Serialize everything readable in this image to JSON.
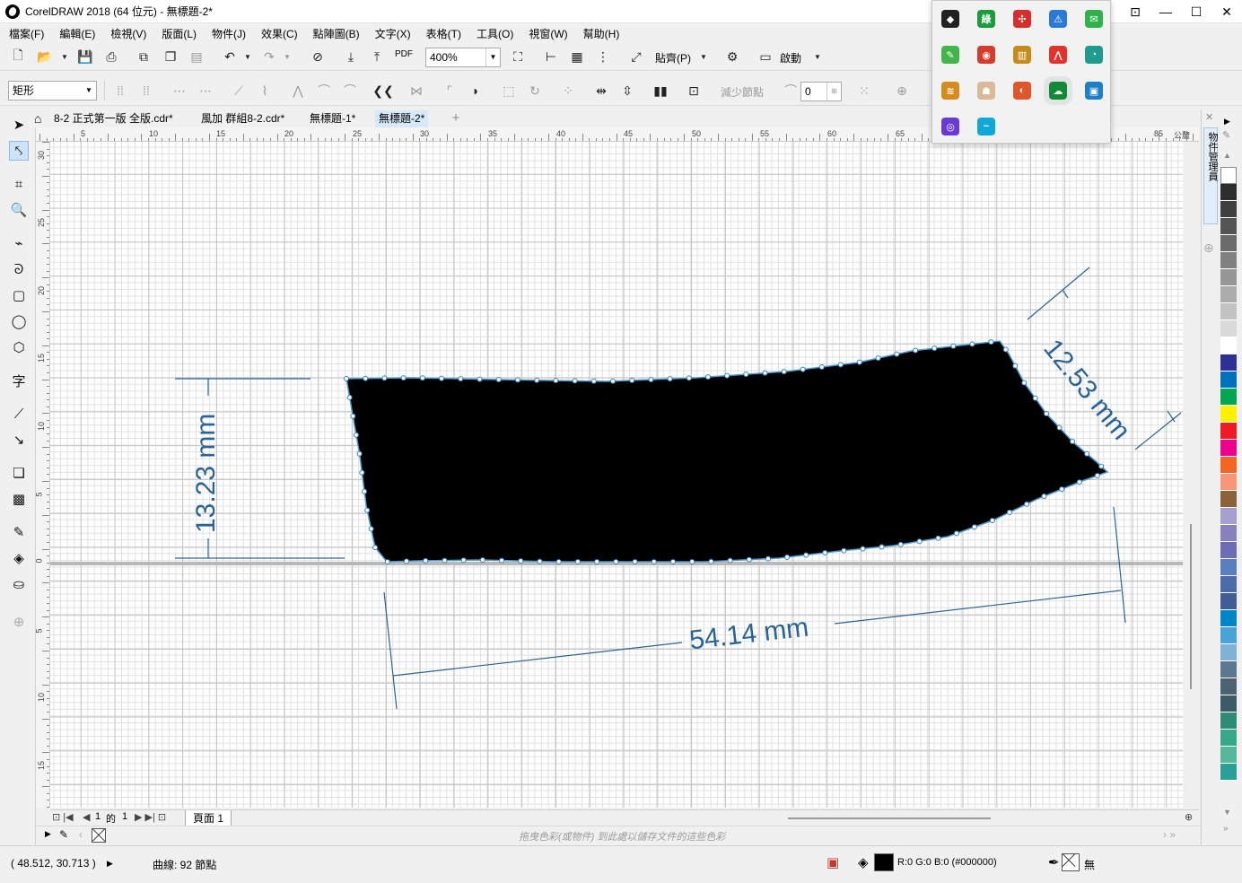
{
  "window": {
    "title": "CorelDRAW 2018 (64 位元) - 無標題-2*"
  },
  "menu": [
    "檔案(F)",
    "編輯(E)",
    "檢視(V)",
    "版面(L)",
    "物件(J)",
    "效果(C)",
    "點陣圖(B)",
    "文字(X)",
    "表格(T)",
    "工具(O)",
    "視窗(W)",
    "幫助(H)"
  ],
  "toolbar": {
    "zoom": "400%",
    "paste_label": "貼齊(P)",
    "launch_label": "啟動",
    "pdf_label": "PDF"
  },
  "propertybar": {
    "shape_type": "矩形",
    "reduce_nodes": "減少節點",
    "smoothness": "0"
  },
  "doc_tabs": [
    "8-2 正式第一版 全版.cdr*",
    "風加 群組8-2.cdr*",
    "無標題-1*",
    "無標題-2*"
  ],
  "ruler": {
    "unit": "公釐",
    "top_labels": [
      "5",
      "10",
      "15",
      "20",
      "25",
      "30",
      "35",
      "40",
      "45",
      "50",
      "55",
      "60",
      "65",
      "85"
    ],
    "left_labels": [
      "30",
      "25",
      "20",
      "15",
      "10",
      "5",
      "0",
      "5",
      "10",
      "15"
    ]
  },
  "dimensions": {
    "height": "13.23 mm",
    "width": "54.14 mm",
    "side": "12.53 mm"
  },
  "page_nav": {
    "current": "1",
    "of": "的",
    "total": "1",
    "page_label": "頁面 1"
  },
  "colorbar": {
    "hint": "拖曳色彩(或物件) 到此處以儲存文件的這些色彩"
  },
  "status": {
    "coords": "( 48.512, 30.713 )",
    "info": "曲線: 92 節點",
    "fill_text": "R:0 G:0 B:0 (#000000)",
    "outline_text": "無",
    "fill_color": "#000000"
  },
  "docker": {
    "label": "物件管理員"
  },
  "palette": [
    "#ffffff",
    "#2d2d2d",
    "#404040",
    "#555555",
    "#6b6b6b",
    "#808080",
    "#969696",
    "#acacac",
    "#c2c2c2",
    "#d9d9d9",
    "#ffffff",
    "#2e3192",
    "#0071bc",
    "#00a651",
    "#fff200",
    "#ed1c24",
    "#ec008c",
    "#f26522",
    "#f7977a",
    "#8c6239",
    "#a3a0d0",
    "#8881c0",
    "#6d6db5",
    "#5a7fbd",
    "#4a6aa8",
    "#3f5e96",
    "#0086c8",
    "#4aa3d6",
    "#7fb3d5",
    "#5c7790",
    "#4a6272",
    "#3c5a66",
    "#2e8b75",
    "#38a88a",
    "#56b79d",
    "#2aa198"
  ],
  "tray_icons": [
    {
      "name": "app-a",
      "color": "#222222",
      "glyph": "◆"
    },
    {
      "name": "app-b",
      "color": "#1c9b3a",
      "glyph": "綠"
    },
    {
      "name": "app-c",
      "color": "#d62d2d",
      "glyph": "✣"
    },
    {
      "name": "app-d",
      "color": "#2b7bd6",
      "glyph": "⚠"
    },
    {
      "name": "app-e",
      "color": "#31b34b",
      "glyph": "✉"
    },
    {
      "name": "app-f",
      "color": "#43b649",
      "glyph": "✎"
    },
    {
      "name": "app-g",
      "color": "#d63a2a",
      "glyph": "◉"
    },
    {
      "name": "app-h",
      "color": "#c68a1d",
      "glyph": "▥"
    },
    {
      "name": "app-i",
      "color": "#e4312b",
      "glyph": "⋀"
    },
    {
      "name": "app-j",
      "color": "#1e9b8f",
      "glyph": "◔"
    },
    {
      "name": "app-k",
      "color": "#d68b1d",
      "glyph": "≋"
    },
    {
      "name": "app-l",
      "color": "#d9b998",
      "glyph": "☗"
    },
    {
      "name": "app-m",
      "color": "#e0562a",
      "glyph": "◐"
    },
    {
      "name": "app-n",
      "color": "#138a3a",
      "glyph": "☁"
    },
    {
      "name": "app-o",
      "color": "#1e7fc8",
      "glyph": "▣"
    },
    {
      "name": "app-p",
      "color": "#6b3ad6",
      "glyph": "◎"
    },
    {
      "name": "app-q",
      "color": "#10a8d8",
      "glyph": "~"
    }
  ]
}
